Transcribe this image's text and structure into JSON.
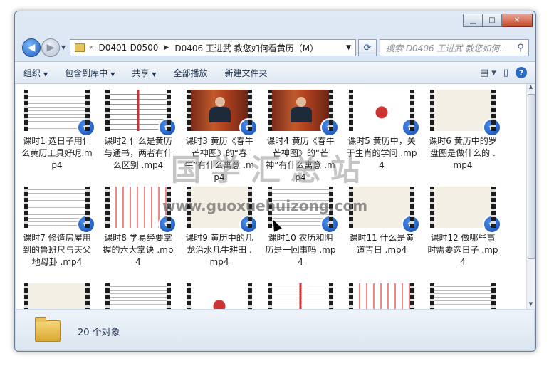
{
  "address": {
    "prefix": "«",
    "segments": [
      "D0401-D0500",
      "D0406 王进武 教您如何看黄历（M）"
    ]
  },
  "search": {
    "placeholder": "搜索 D0406 王进武 教您如何..."
  },
  "toolbar": {
    "items": [
      "组织",
      "包含到库中",
      "共享",
      "全部播放",
      "新建文件夹"
    ]
  },
  "files": [
    {
      "label": "课时1 选日子用什么黄历工具好呢.mp4",
      "thumb": "doc"
    },
    {
      "label": "课时2 什么是黄历与通书，两者有什么区别 .mp4",
      "thumb": "table"
    },
    {
      "label": "课时3 黄历《春牛芒神图》的“春牛”有什么寓意 .mp4",
      "thumb": "person"
    },
    {
      "label": "课时4 黄历《春牛芒神图》的“芒神”有什么寓意 .mp4",
      "thumb": "person"
    },
    {
      "label": "课时5 黄历中，关于生肖的学问 .mp4",
      "thumb": "red"
    },
    {
      "label": "课时6 黄历中的罗盘图是做什么的 .mp4",
      "thumb": "slide"
    },
    {
      "label": "课时7 修造房屋用到的鲁班尺与天父地母卦 .mp4",
      "thumb": "doc"
    },
    {
      "label": "课时8 学易经要掌握的六大掌诀 .mp4",
      "thumb": "pink"
    },
    {
      "label": "课时9 黄历中的几龙治水几牛耕田 .mp4",
      "thumb": "slide"
    },
    {
      "label": "课时10 农历和阴历是一回事吗 .mp4",
      "thumb": "doc"
    },
    {
      "label": "课时11 什么是黄道吉日 .mp4",
      "thumb": "slide"
    },
    {
      "label": "课时12 做哪些事时需要选日子 .mp4",
      "thumb": "slide"
    },
    {
      "label": "",
      "thumb": "slide"
    },
    {
      "label": "",
      "thumb": "doc"
    },
    {
      "label": "",
      "thumb": "red"
    },
    {
      "label": "",
      "thumb": "table"
    },
    {
      "label": "",
      "thumb": "pink"
    },
    {
      "label": "",
      "thumb": "doc"
    }
  ],
  "status": {
    "count": "20 个对象"
  },
  "watermark": {
    "big": "国学汇总站",
    "url": "www.guoxuehuizong.com"
  },
  "colors": {
    "accent": "#2a6cc4",
    "badge": "#1f5fb8"
  }
}
